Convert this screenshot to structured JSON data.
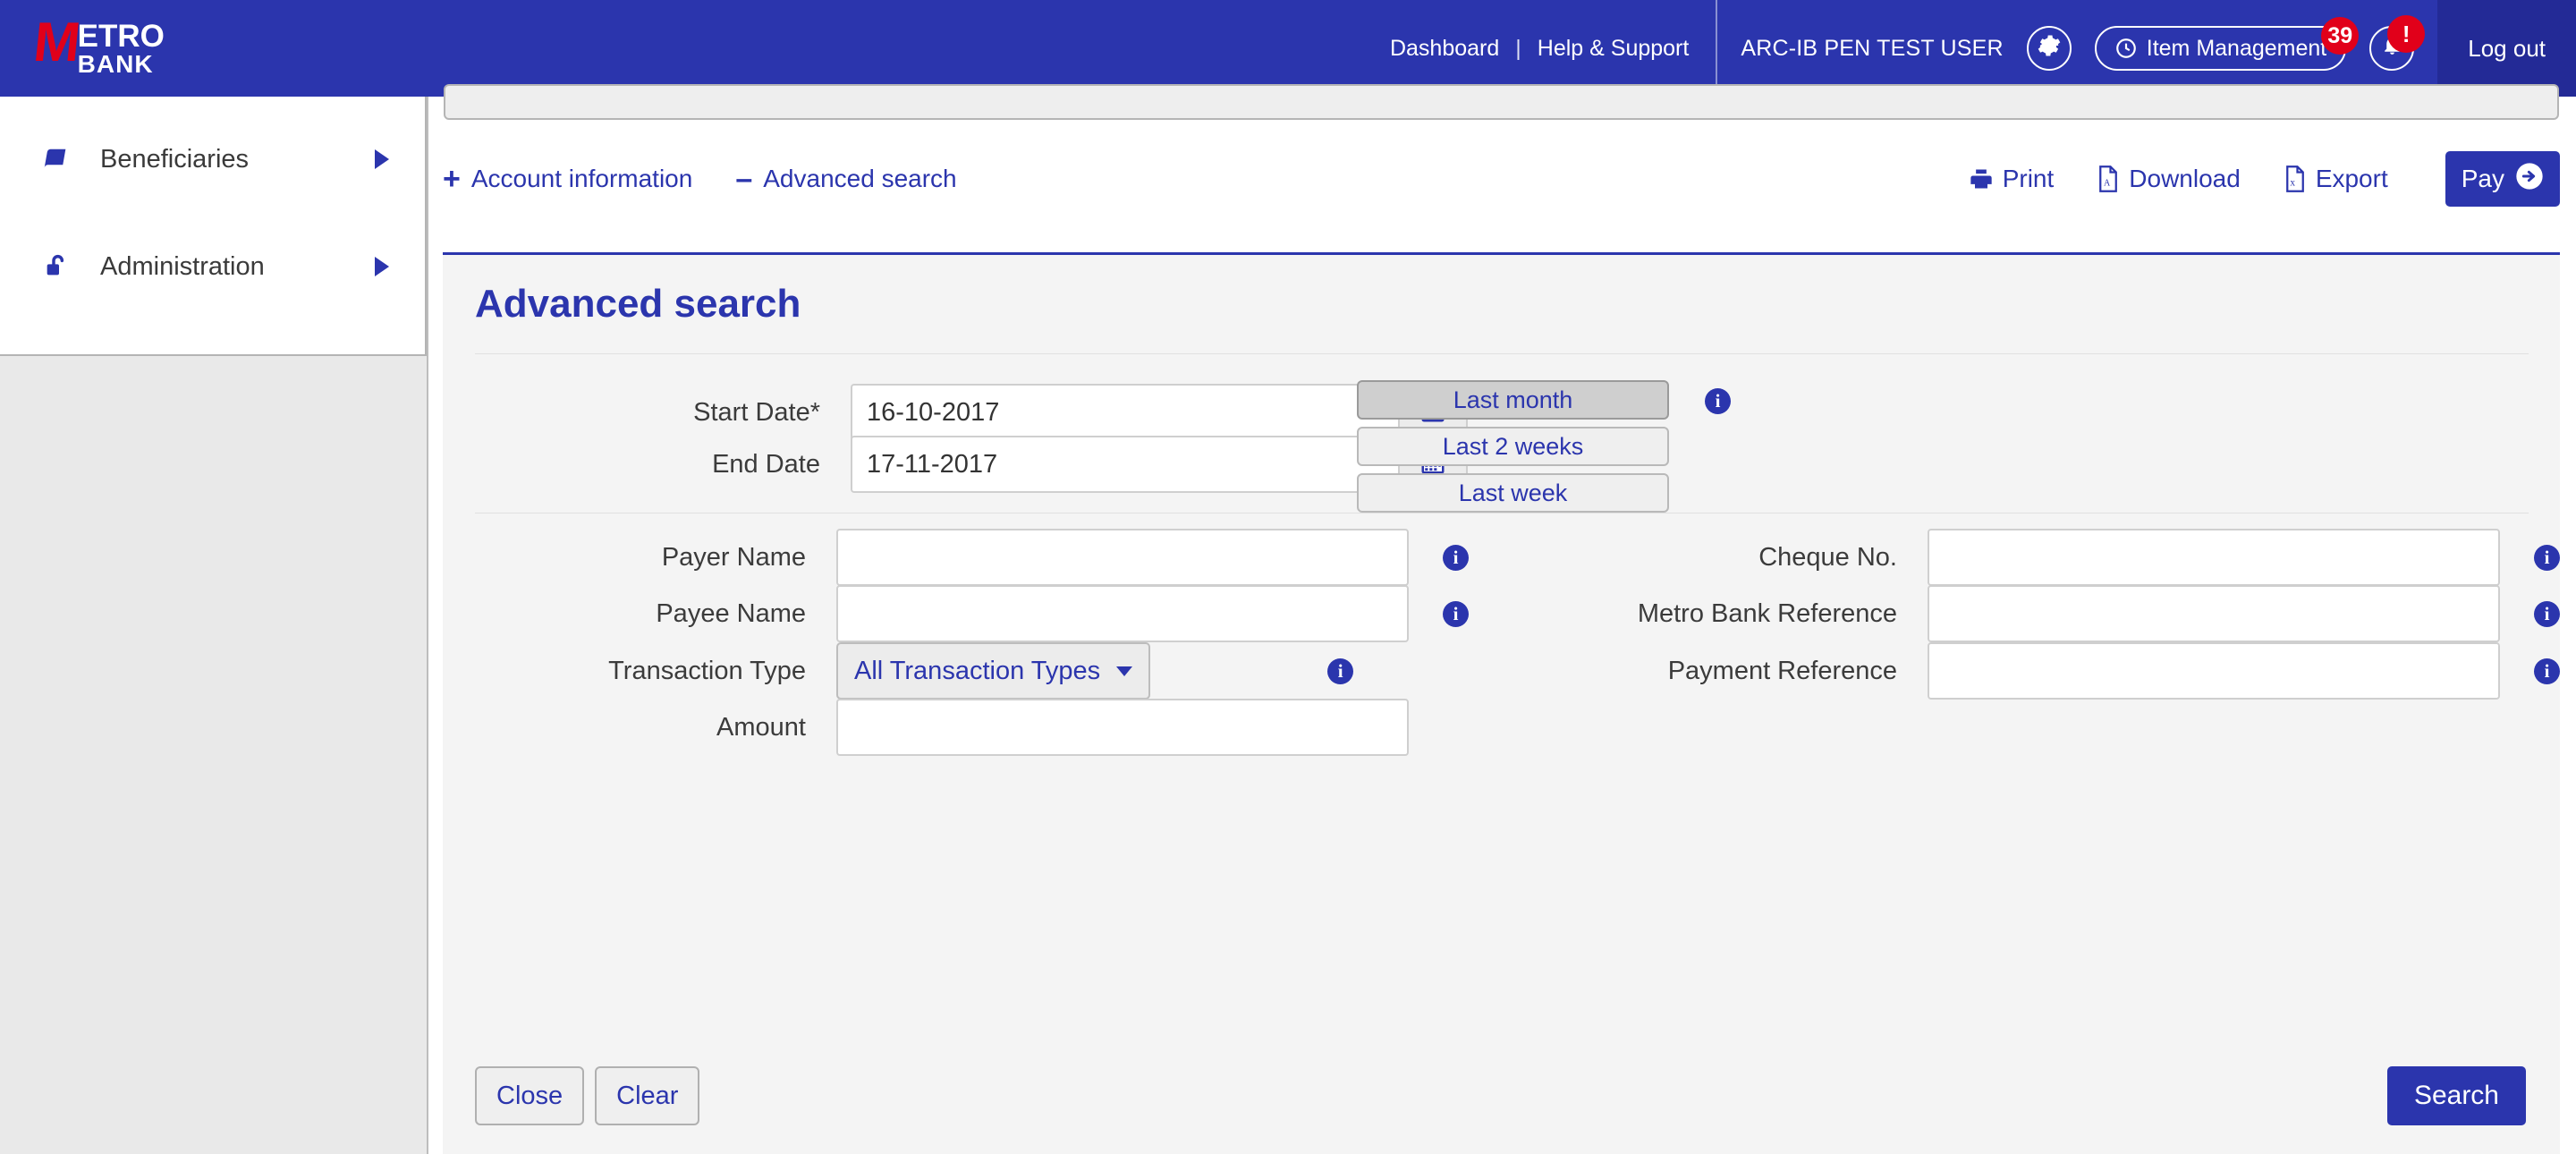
{
  "header": {
    "logo": {
      "m": "M",
      "etro": "ETRO",
      "bank": "BANK"
    },
    "dashboard_label": "Dashboard",
    "separator": "|",
    "help_label": "Help & Support",
    "user_label": "ARC-IB PEN TEST USER",
    "gear_icon": "gear-icon",
    "item_management_label": "Item Management",
    "item_management_badge": "39",
    "notifications_badge": "!",
    "logout_label": "Log out"
  },
  "sidebar": {
    "items": [
      {
        "label": "Beneficiaries",
        "icon": "book-icon"
      },
      {
        "label": "Administration",
        "icon": "unlock-icon"
      }
    ]
  },
  "toolbar": {
    "account_information_label": "Account information",
    "account_information_sign": "+",
    "advanced_search_label": "Advanced search",
    "advanced_search_sign": "–",
    "print_label": "Print",
    "download_label": "Download",
    "export_label": "Export",
    "pay_label": "Pay"
  },
  "advanced_search": {
    "title": "Advanced search",
    "start_date": {
      "label": "Start Date*",
      "value": "16-10-2017"
    },
    "end_date": {
      "label": "End Date",
      "value": "17-11-2017"
    },
    "quick_ranges": [
      {
        "label": "Last month",
        "active": true
      },
      {
        "label": "Last 2 weeks",
        "active": false
      },
      {
        "label": "Last week",
        "active": false
      }
    ],
    "fields_left": [
      {
        "label": "Payer Name",
        "value": "",
        "type": "text"
      },
      {
        "label": "Payee Name",
        "value": "",
        "type": "text"
      },
      {
        "label": "Transaction Type",
        "value": "All Transaction Types",
        "type": "select"
      },
      {
        "label": "Amount",
        "value": "",
        "type": "text"
      }
    ],
    "fields_right": [
      {
        "label": "Cheque No.",
        "value": ""
      },
      {
        "label": "Metro Bank Reference",
        "value": ""
      },
      {
        "label": "Payment Reference",
        "value": ""
      }
    ],
    "close_label": "Close",
    "clear_label": "Clear",
    "search_label": "Search"
  },
  "colors": {
    "brand_blue": "#2b35ad",
    "brand_dark_blue": "#232a96",
    "brand_red": "#e1001a",
    "panel_bg": "#f4f4f4"
  }
}
